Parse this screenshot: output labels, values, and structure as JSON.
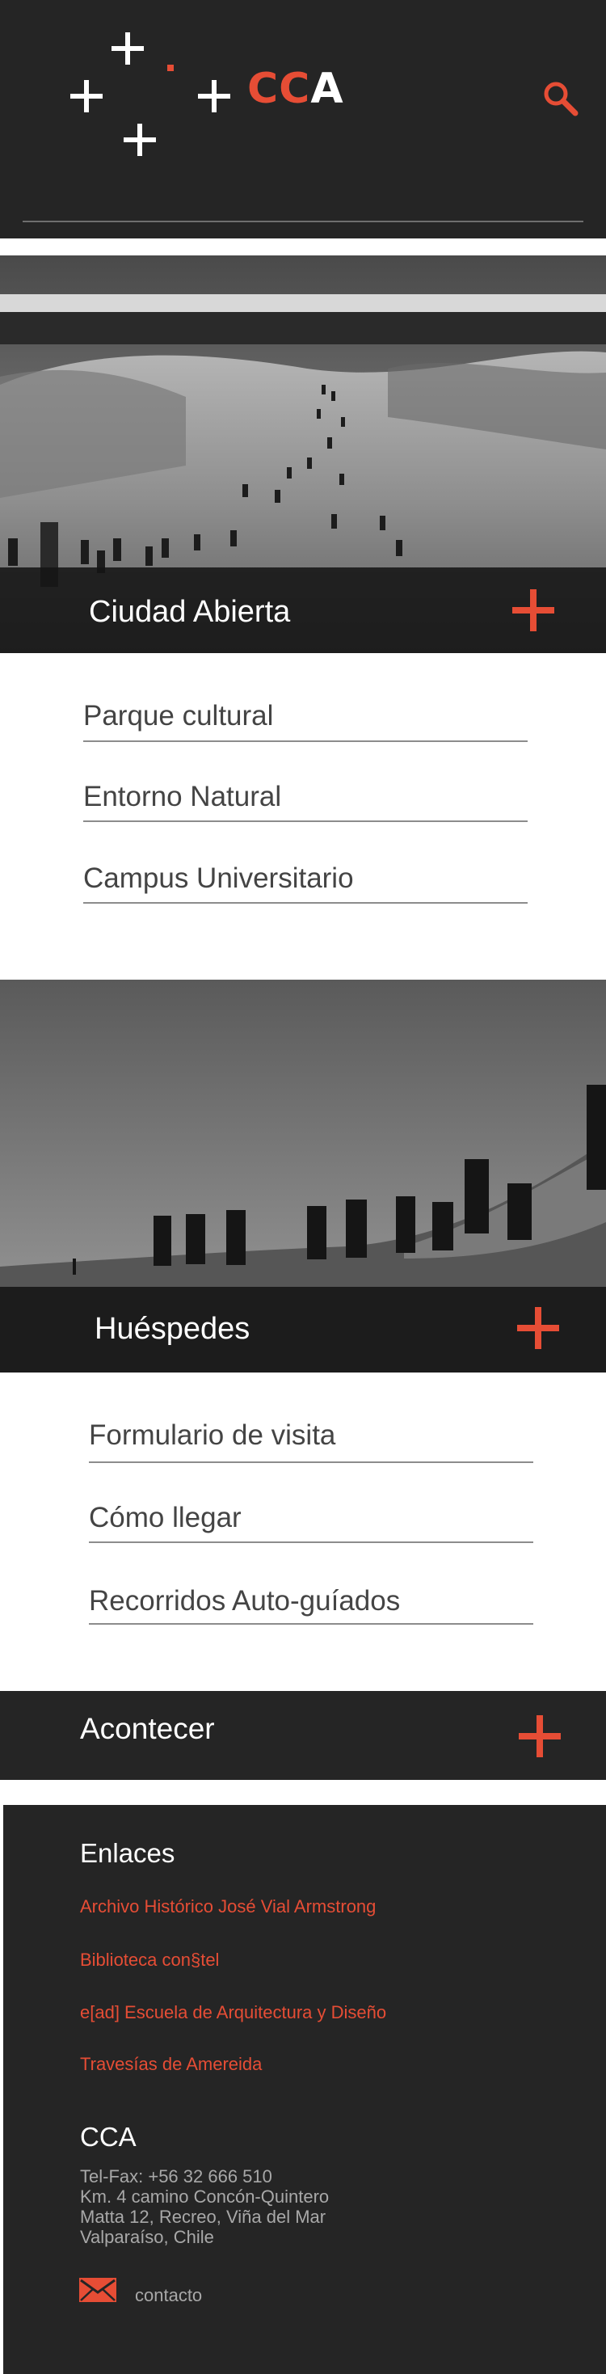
{
  "header": {
    "logo": {
      "red_part": "CC",
      "white_part": "A"
    },
    "search_icon": "search-icon"
  },
  "colors": {
    "accent": "#e64d35",
    "dark": "#252525",
    "text": "#444444"
  },
  "section_ciudad": {
    "title": "Ciudad Abierta",
    "expand_icon": "plus-icon",
    "links": [
      "Parque cultural",
      "Entorno Natural",
      "Campus Universitario"
    ]
  },
  "section_huespedes": {
    "title": "Huéspedes",
    "expand_icon": "plus-icon",
    "links": [
      "Formulario de visita",
      "Cómo llegar",
      "Recorridos Auto-guíados"
    ]
  },
  "section_acontecer": {
    "title": "Acontecer",
    "expand_icon": "plus-icon"
  },
  "footer": {
    "enlaces_heading": "Enlaces",
    "enlaces": [
      "Archivo Histórico José Vial Armstrong",
      "Biblioteca con§tel",
      "e[ad] Escuela de Arquitectura y Diseño",
      "Travesías de Amereida"
    ],
    "cca_heading": "CCA",
    "address_lines": [
      "Tel-Fax: +56 32 666 510",
      "Km. 4 camino Concón-Quintero",
      "Matta 12, Recreo, Viña del Mar",
      "Valparaíso, Chile"
    ],
    "contact_label": "contacto",
    "contact_icon": "mail-icon"
  }
}
